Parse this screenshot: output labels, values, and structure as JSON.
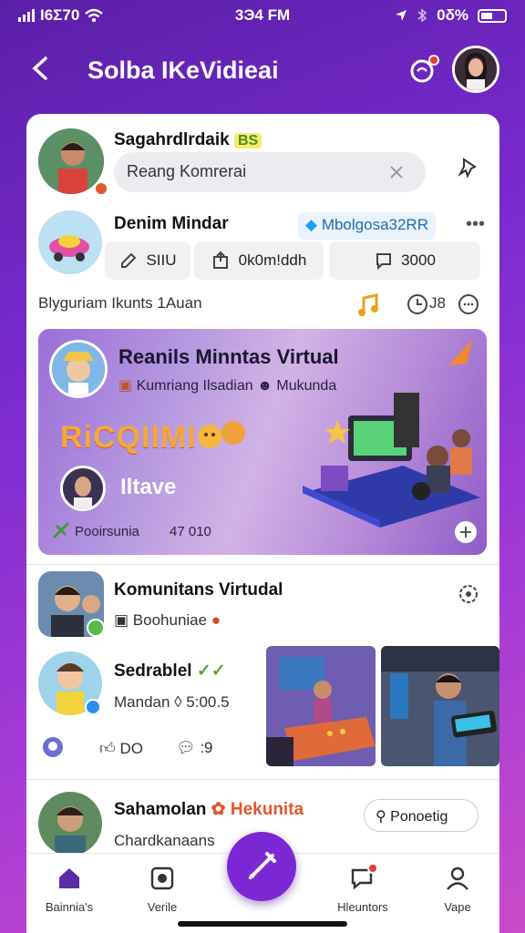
{
  "status_bar": {
    "carrier": "I6Σ70",
    "time": "3Э4 FM",
    "battery": "0δ%"
  },
  "header": {
    "title": "Solba IKeVidieai"
  },
  "post1": {
    "name": "Sagahrdlrdaik",
    "badge": "BS",
    "search_value": "Reang Komrerai"
  },
  "post2": {
    "name": "Denim Mindar",
    "tag": "Mbolgosa32RR",
    "actions": [
      "SIIU",
      "0k0m!ddh",
      "3000"
    ]
  },
  "meta_row": {
    "text": "Blyguriam Ikunts 1Auan",
    "count": "J8"
  },
  "promo": {
    "title": "Reanils Minntas Virtual",
    "subtitle": "Kumriang Ilsadian",
    "subtitle2": "Mukunda",
    "big_text": "RiCQIIMI",
    "name": "Iltave",
    "footer_label": "Pooirsunia",
    "footer_count": "47 010"
  },
  "post3": {
    "name": "Komunitans Virtudal",
    "sub": "Boohuniae"
  },
  "post4": {
    "name": "Sedrablel",
    "line": "Mandan ◊ 5:00.5",
    "likes": "DO",
    "comments": ":9"
  },
  "post5": {
    "name": "Sahamolan",
    "name_accent": "Hekunita",
    "sub": "Chardkanaans",
    "button": "Ponoetig"
  },
  "bottom_nav": [
    "Bainnia's",
    "Verile",
    "Hleuntors",
    "Vape"
  ],
  "colors": {
    "accent": "#7b28d4",
    "background": "#7a2bd0",
    "badge": "#e53935"
  }
}
